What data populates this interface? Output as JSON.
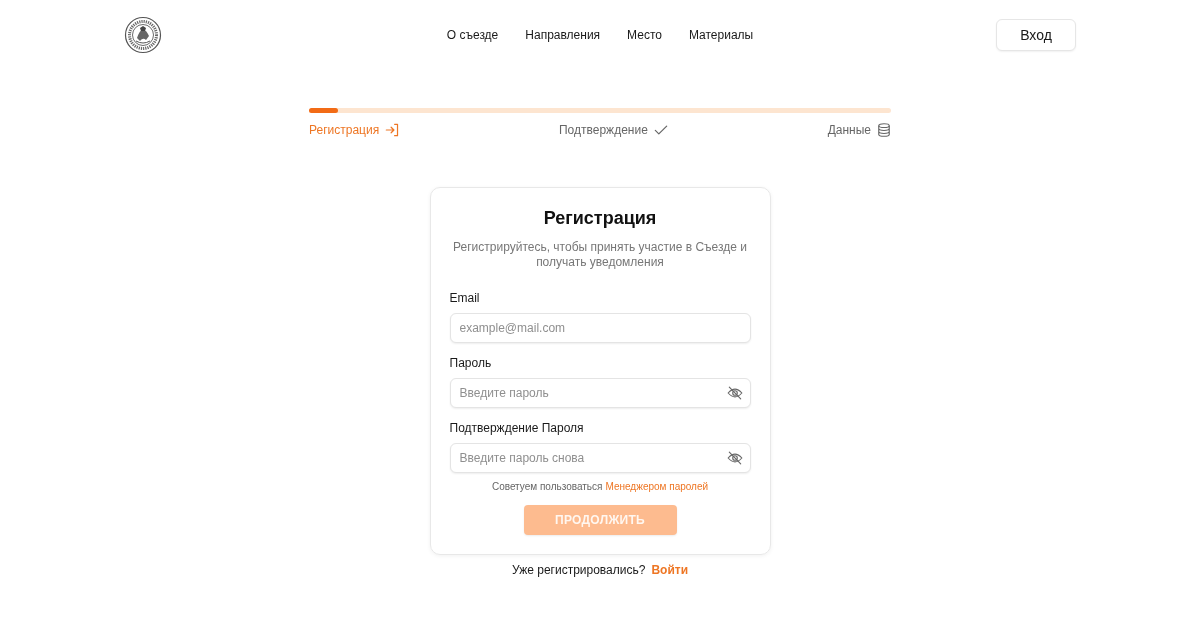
{
  "header": {
    "nav": [
      "О съезде",
      "Направления",
      "Место",
      "Материалы"
    ],
    "login_button": "Вход"
  },
  "progress": {
    "level": 0.05,
    "steps": [
      {
        "label": "Регистрация",
        "current": true
      },
      {
        "label": "Подтверждение",
        "current": false
      },
      {
        "label": "Данные",
        "current": false
      }
    ]
  },
  "form": {
    "title": "Регистрация",
    "subtitle": "Регистрируйтесь, чтобы принять участие в Съезде и получать уведомления",
    "fields": [
      {
        "kind": "email",
        "label": "Email",
        "placeholder": "example@mail.com"
      },
      {
        "kind": "password",
        "label": "Пароль",
        "placeholder": "Введите пароль"
      },
      {
        "kind": "password",
        "label": "Подтверждение Пароля",
        "placeholder": "Введите пароль снова"
      }
    ],
    "hint": {
      "text": "Советуем пользоваться",
      "link": "Менеджером паролей"
    },
    "submit": {
      "label": "ПРОДОЛЖИТЬ",
      "disabled": true
    }
  },
  "footer": {
    "text": "Уже регистрировались?",
    "link": "Войти"
  }
}
